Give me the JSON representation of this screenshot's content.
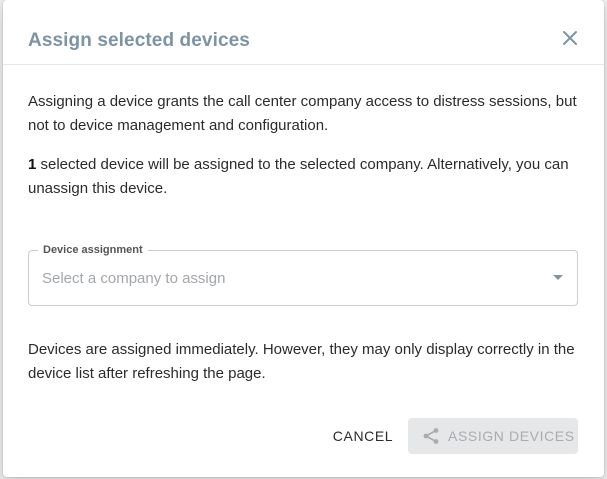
{
  "dialog": {
    "title": "Assign selected devices",
    "intro": "Assigning a device grants the call center company access to distress sessions, but not to device management and configuration.",
    "selected_count": "1",
    "selection_text": " selected device will be assigned to the selected company. Alternatively, you can unassign this device.",
    "field": {
      "label": "Device assignment",
      "placeholder": "Select a company to assign",
      "value": ""
    },
    "note": "Devices are assigned immediately. However, they may only display correctly in the device list after refreshing the page.",
    "actions": {
      "cancel_label": "CANCEL",
      "assign_label": "ASSIGN DEVICES",
      "assign_enabled": false
    }
  },
  "icons": {
    "close": "close-icon",
    "caret": "chevron-down-icon",
    "assign": "share-icon"
  },
  "colors": {
    "title": "#7d93a6",
    "text": "#2b2b2b",
    "placeholder": "#a3a7ab",
    "disabled_bg": "#e6e7e8",
    "disabled_text": "#a9adb1"
  }
}
